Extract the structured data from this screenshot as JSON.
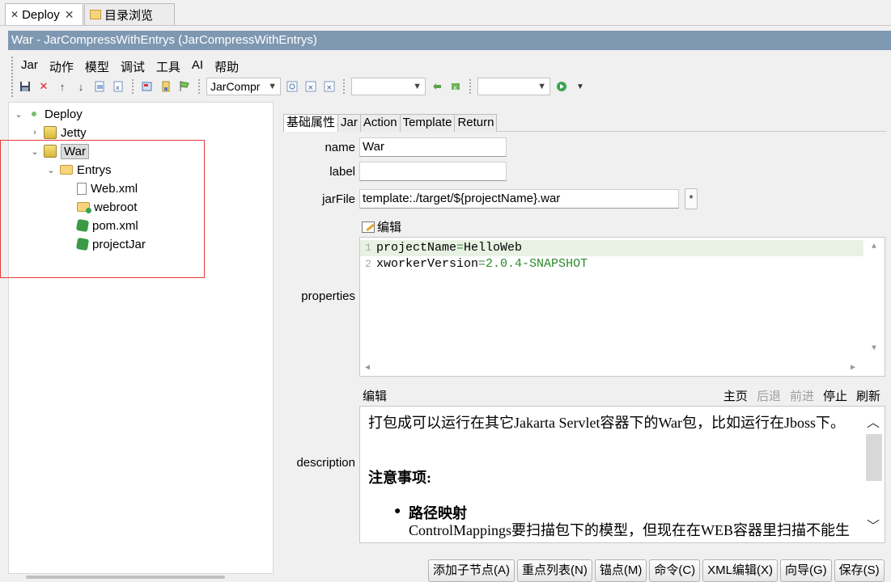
{
  "tabs": [
    {
      "label": "Deploy",
      "active": true,
      "closable": true,
      "icon": "deploy-icon"
    },
    {
      "label": "目录浏览",
      "active": false,
      "icon": "folder-icon"
    }
  ],
  "title": "War - JarCompressWithEntrys  (JarCompressWithEntrys)",
  "menu": [
    "Jar",
    "动作",
    "模型",
    "调试",
    "工具",
    "AI",
    "帮助"
  ],
  "toolbar": {
    "combo1_value": "JarCompr",
    "combo2_value": "",
    "combo3_value": ""
  },
  "tree": {
    "root": "Deploy",
    "jetty": "Jetty",
    "war": "War",
    "entrys": "Entrys",
    "webxml": "Web.xml",
    "webroot": "webroot",
    "pomxml": "pom.xml",
    "projectjar": "projectJar"
  },
  "prop_tabs": [
    "基础属性",
    "Jar",
    "Action",
    "Template",
    "Return"
  ],
  "form": {
    "name_label": "name",
    "name_value": "War",
    "label_label": "label",
    "label_value": "",
    "jarfile_label": "jarFile",
    "jarfile_value": "template:./target/${projectName}.war",
    "star": "*",
    "edit_link": "编辑",
    "properties_label": "properties",
    "description_label": "description"
  },
  "properties_code": [
    {
      "num": "1",
      "key": "projectName",
      "eq": "=",
      "val": "HelloWeb"
    },
    {
      "num": "2",
      "key": "xworkerVersion",
      "eq": "=",
      "val": "2.0.4-SNAPSHOT"
    }
  ],
  "browser": {
    "edit": "编辑",
    "home": "主页",
    "back": "后退",
    "forward": "前进",
    "stop": "停止",
    "refresh": "刷新"
  },
  "description": {
    "para1": "打包成可以运行在其它Jakarta Servlet容器下的War包，比如运行在Jboss下。",
    "heading": "注意事项:",
    "bullet_title": "路径映射",
    "bullet_text": "ControlMappings要扫描包下的模型，但现在在WEB容器里扫描不能生效了，故可能需要手工通过模型菜单把目录下的映射转"
  },
  "buttons": [
    "添加子节点(A)",
    "重点列表(N)",
    "锚点(M)",
    "命令(C)",
    "XML编辑(X)",
    "向导(G)",
    "保存(S)"
  ]
}
